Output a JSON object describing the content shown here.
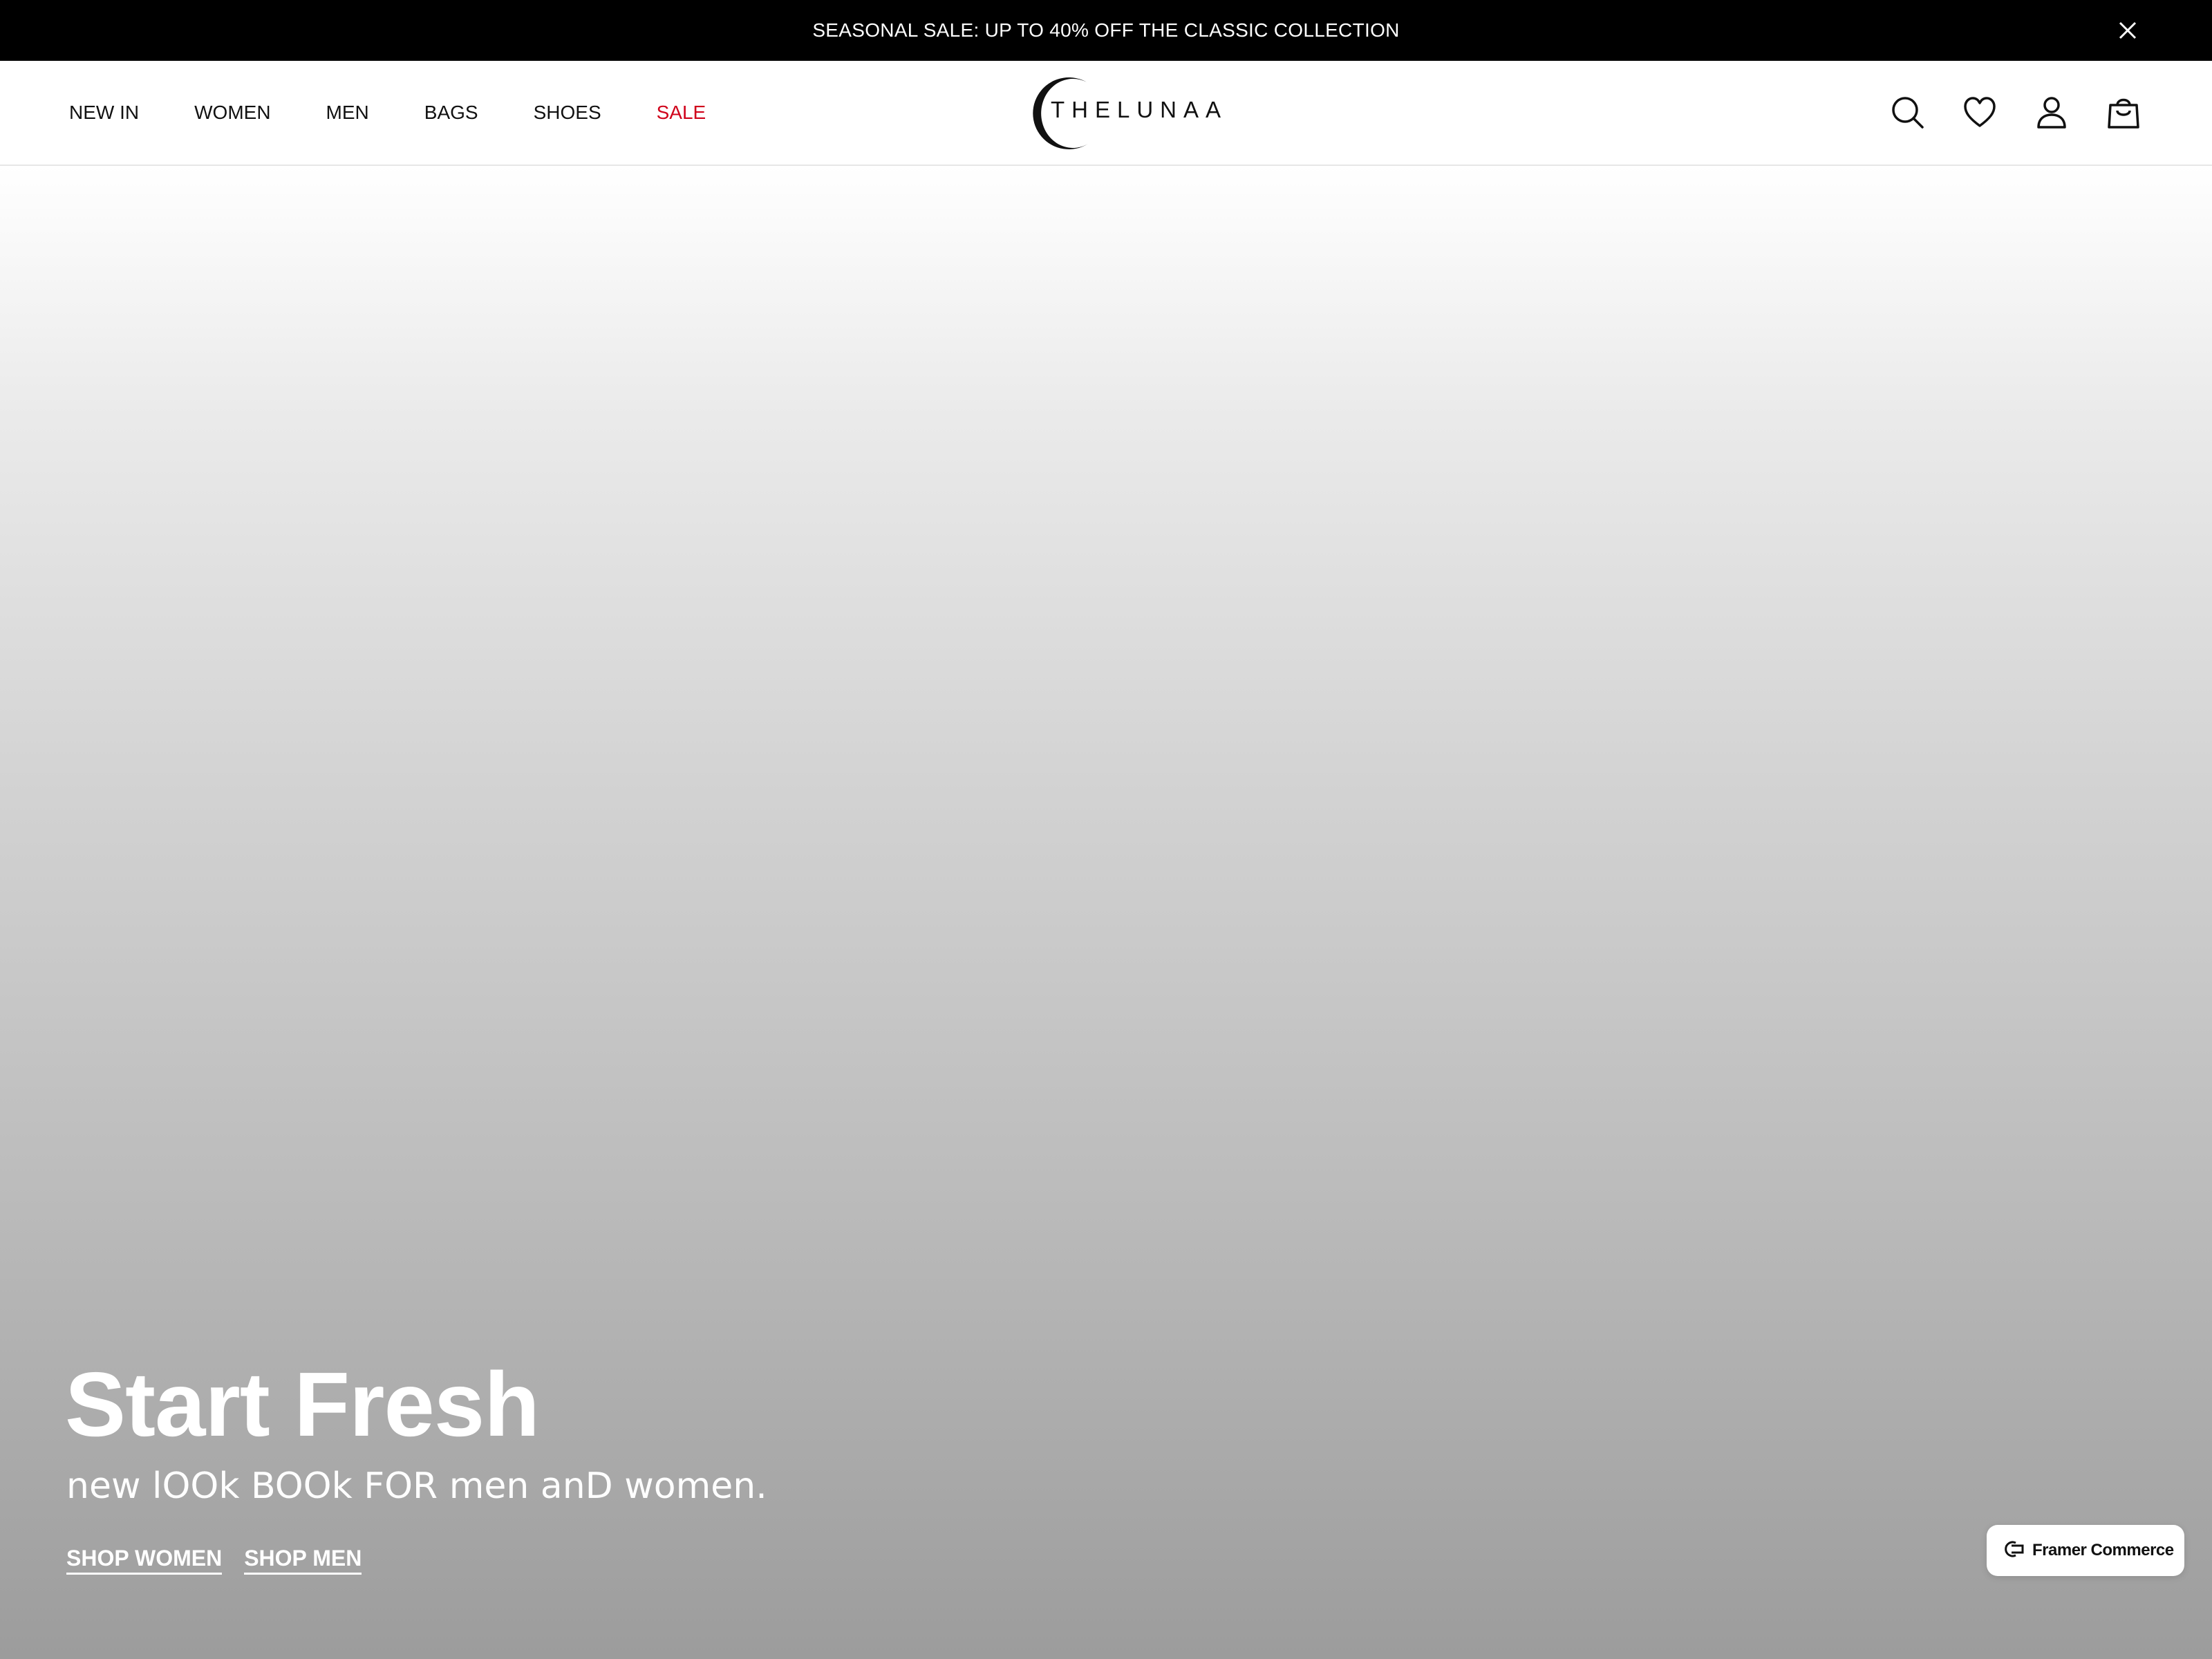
{
  "announcement": {
    "text": "SEASONAL SALE: UP TO 40% OFF THE CLASSIC COLLECTION",
    "close_icon": "close-icon",
    "background": "#000000",
    "color": "#ffffff"
  },
  "nav": {
    "items": [
      {
        "label": "NEW IN"
      },
      {
        "label": "WOMEN"
      },
      {
        "label": "MEN"
      },
      {
        "label": "BAGS"
      },
      {
        "label": "SHOES"
      },
      {
        "label": "SALE",
        "color": "#d0021b"
      }
    ]
  },
  "logo": {
    "text": "THELUNAA"
  },
  "header_icons": [
    "search-icon",
    "heart-icon",
    "user-icon",
    "shopping-bag-icon"
  ],
  "hero": {
    "title": "Start Fresh",
    "subtitle": "new lOOk BOOk FOR men anD women.",
    "ctas": [
      {
        "label": "SHOP WOMEN"
      },
      {
        "label": "SHOP MEN"
      }
    ]
  },
  "badge": {
    "text": "Framer Commerce",
    "icon": "framer-commerce-icon"
  }
}
